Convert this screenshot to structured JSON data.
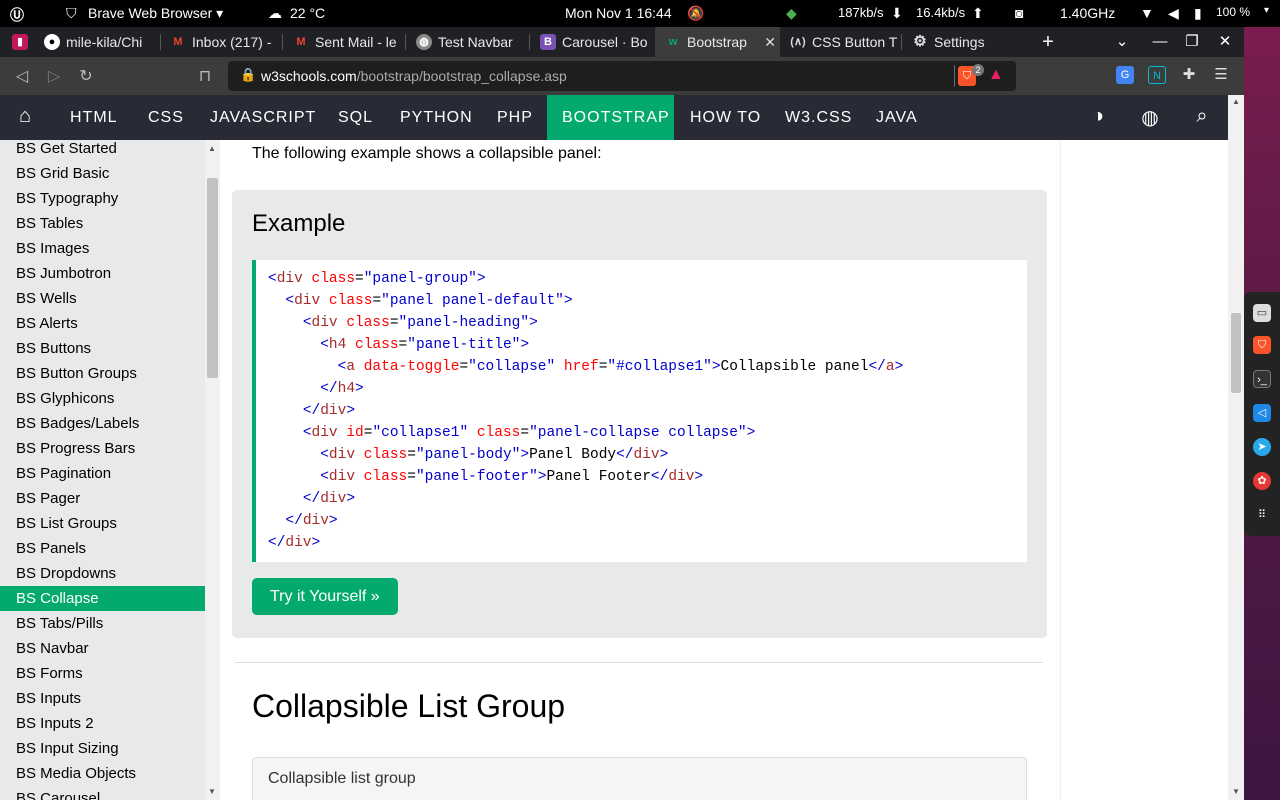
{
  "system": {
    "app_name": "Brave Web Browser",
    "weather": "22 °C",
    "datetime": "Mon Nov 1  16:44",
    "net_down": "187kb/s",
    "net_up": "16.4kb/s",
    "cpu": "1.40GHz",
    "battery": "100 %"
  },
  "tabs": [
    {
      "label": "mile-kila/Chi",
      "icon": "github-icon"
    },
    {
      "label": "Inbox (217) -",
      "icon": "gmail-icon"
    },
    {
      "label": "Sent Mail - le",
      "icon": "gmail-icon"
    },
    {
      "label": "Test Navbar",
      "icon": "globe-icon"
    },
    {
      "label": "Carousel · Bo",
      "icon": "bootstrap-icon"
    },
    {
      "label": "Bootstrap",
      "icon": "w3schools-icon"
    },
    {
      "label": "CSS Button T",
      "icon": "css-icon"
    },
    {
      "label": "Settings",
      "icon": "gear-icon"
    }
  ],
  "url": {
    "domain": "w3schools.com",
    "path": "/bootstrap/bootstrap_collapse.asp"
  },
  "brave_badge": "2",
  "topnav": [
    "HTML",
    "CSS",
    "JAVASCRIPT",
    "SQL",
    "PYTHON",
    "PHP",
    "BOOTSTRAP",
    "HOW TO",
    "W3.CSS",
    "JAVA"
  ],
  "sidebar": [
    "BS Get Started",
    "BS Grid Basic",
    "BS Typography",
    "BS Tables",
    "BS Images",
    "BS Jumbotron",
    "BS Wells",
    "BS Alerts",
    "BS Buttons",
    "BS Button Groups",
    "BS Glyphicons",
    "BS Badges/Labels",
    "BS Progress Bars",
    "BS Pagination",
    "BS Pager",
    "BS List Groups",
    "BS Panels",
    "BS Dropdowns",
    "BS Collapse",
    "BS Tabs/Pills",
    "BS Navbar",
    "BS Forms",
    "BS Inputs",
    "BS Inputs 2",
    "BS Input Sizing",
    "BS Media Objects",
    "BS Carousel"
  ],
  "content": {
    "intro": "The following example shows a collapsible panel:",
    "example_heading": "Example",
    "try_button": "Try it Yourself »",
    "section_heading": "Collapsible List Group",
    "list_group_title": "Collapsible list group"
  },
  "code_lines": [
    "<div class=\"panel-group\">",
    "  <div class=\"panel panel-default\">",
    "    <div class=\"panel-heading\">",
    "      <h4 class=\"panel-title\">",
    "        <a data-toggle=\"collapse\" href=\"#collapse1\">Collapsible panel</a>",
    "      </h4>",
    "    </div>",
    "    <div id=\"collapse1\" class=\"panel-collapse collapse\">",
    "      <div class=\"panel-body\">Panel Body</div>",
    "      <div class=\"panel-footer\">Panel Footer</div>",
    "    </div>",
    "  </div>",
    "</div>"
  ]
}
